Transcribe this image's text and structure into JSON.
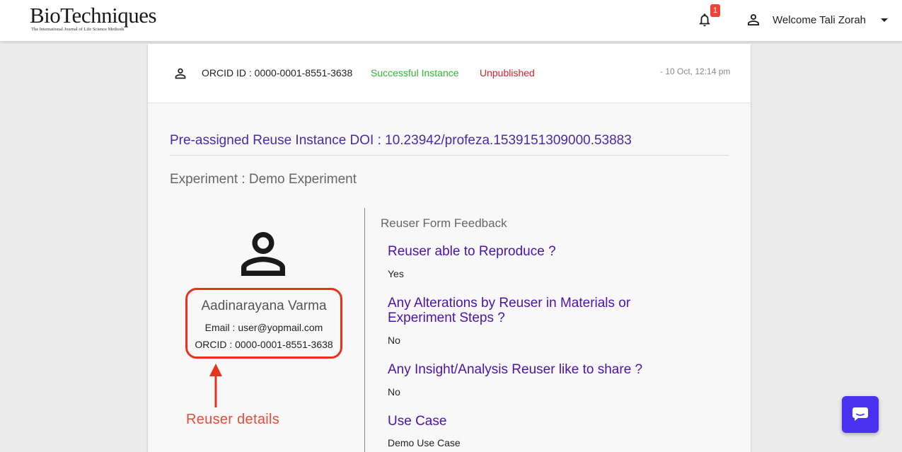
{
  "header": {
    "logo_text": "BioTechniques",
    "logo_subtitle": "The International Journal of Life Science Methods",
    "notification_count": "1",
    "welcome_text": "Welcome Tali Zorah"
  },
  "instance": {
    "orcid_label": "ORCID ID : 0000-0001-8551-3638",
    "status": "Successful Instance",
    "publish_state": "Unpublished",
    "timestamp": "- 10 Oct, 12:14 pm",
    "doi": "Pre-assigned Reuse Instance DOI : 10.23942/profeza.1539151309000.53883",
    "experiment": "Experiment : Demo Experiment"
  },
  "reuser": {
    "name": "Aadinarayana Varma",
    "email": "Email : user@yopmail.com",
    "orcid": "ORCID : 0000-0001-8551-3638",
    "annotation": "Reuser details"
  },
  "feedback": {
    "title": "Reuser Form Feedback",
    "items": [
      {
        "question": "Reuser able to Reproduce ?",
        "answer": "Yes"
      },
      {
        "question": "Any Alterations by Reuser in Materials or Experiment Steps ?",
        "answer": "No"
      },
      {
        "question": "Any Insight/Analysis Reuser like to share ?",
        "answer": "No"
      },
      {
        "question": "Use Case",
        "answer": "Demo Use Case"
      }
    ]
  },
  "colors": {
    "accent_purple": "#4a12b0",
    "success_green": "#2eb82e",
    "unpublished_red": "#e0202a",
    "annotation_red": "#e8321e",
    "chat_blue": "#4a31f0"
  },
  "icons": {
    "bell": "bell-icon",
    "user": "person-outline-icon",
    "chat": "chat-bubble-icon"
  }
}
